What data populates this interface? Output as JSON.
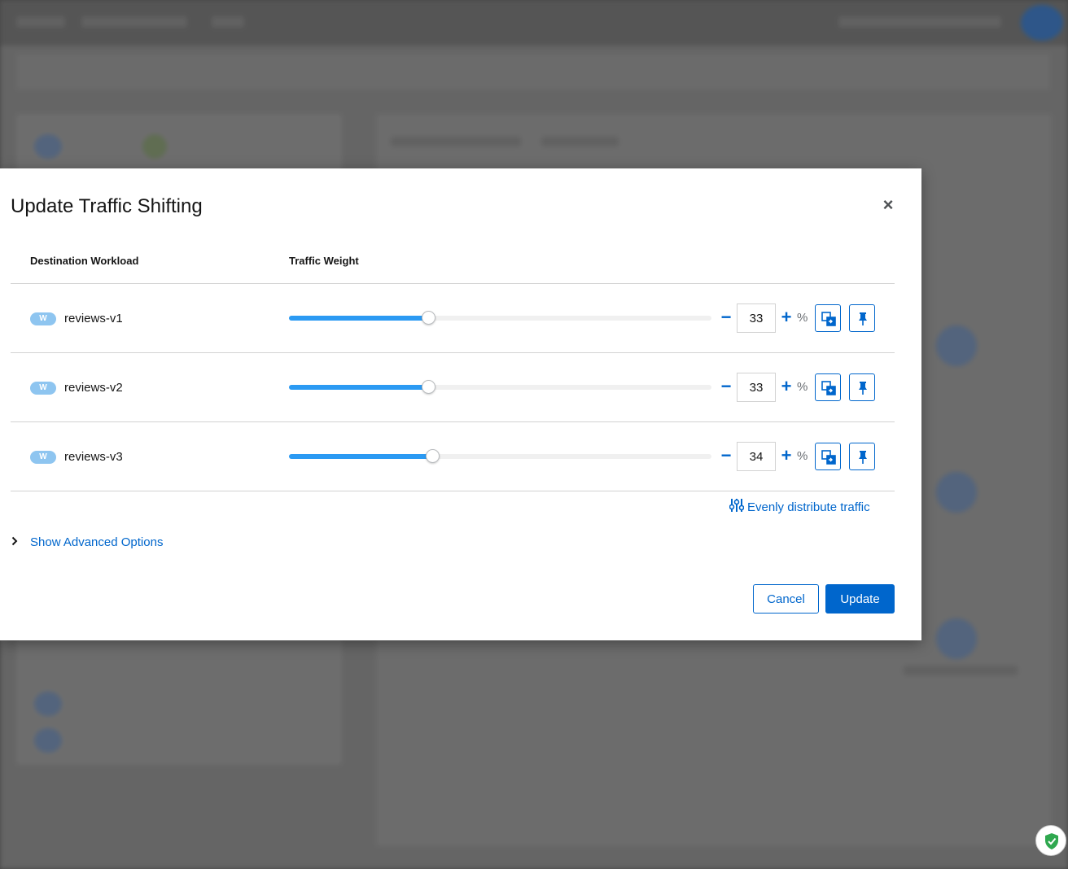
{
  "modal": {
    "title": "Update Traffic Shifting",
    "close_label": "×",
    "columns": {
      "workload": "Destination Workload",
      "weight": "Traffic Weight"
    },
    "rows": [
      {
        "badge": "W",
        "name": "reviews-v1",
        "weight": "33",
        "weight_fraction": 0.33,
        "unit": "%"
      },
      {
        "badge": "W",
        "name": "reviews-v2",
        "weight": "33",
        "weight_fraction": 0.33,
        "unit": "%"
      },
      {
        "badge": "W",
        "name": "reviews-v3",
        "weight": "34",
        "weight_fraction": 0.34,
        "unit": "%"
      }
    ],
    "evenly_label": "Evenly distribute traffic",
    "advanced_label": "Show Advanced Options",
    "cancel_label": "Cancel",
    "update_label": "Update"
  },
  "colors": {
    "accent": "#0066cc",
    "slider_fill": "#2b9af3",
    "badge": "#8ec5f0"
  },
  "icons": {
    "mirror": "copy-mirror-icon",
    "pin": "thumbtack-icon",
    "distribute": "sliders-icon",
    "chevron": "chevron-right-icon",
    "shield": "shield-check-icon"
  }
}
